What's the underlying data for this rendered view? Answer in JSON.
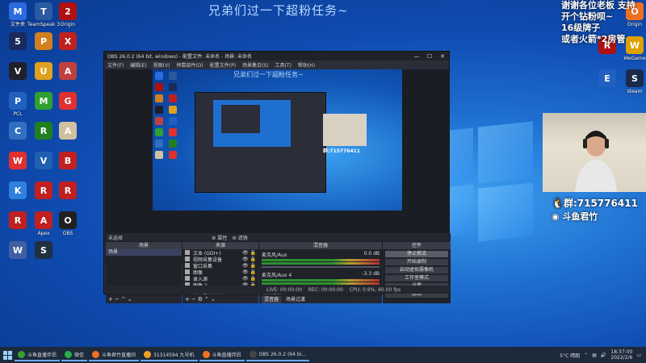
{
  "banner": "兄弟们过一下超粉任务~",
  "right_overlay": {
    "lines": [
      "谢谢各位老板 支持",
      "开个钻粉呗~",
      "16级牌子",
      "或者火箭*2房管"
    ],
    "qq": "群:715776411",
    "douyu": "斗鱼君竹"
  },
  "desktop_icons_left": [
    {
      "label": "文件夹",
      "color": "#2b6be0",
      "glyph": "M"
    },
    {
      "label": "TeamSpeak 3",
      "color": "#2a5aa0",
      "glyph": "T"
    },
    {
      "label": "Origin",
      "color": "#b01010",
      "glyph": "2"
    },
    {
      "label": "",
      "color": "#1a2a5a",
      "glyph": "5"
    },
    {
      "label": "",
      "color": "#d08020",
      "glyph": "P"
    },
    {
      "label": "",
      "color": "#c02020",
      "glyph": "X"
    },
    {
      "label": "",
      "color": "#20202a",
      "glyph": "V"
    },
    {
      "label": "",
      "color": "#e0a020",
      "glyph": "U"
    },
    {
      "label": "",
      "color": "#c04040",
      "glyph": "A"
    },
    {
      "label": "PCL",
      "color": "#2060c0",
      "glyph": "P"
    },
    {
      "label": "",
      "color": "#30a030",
      "glyph": "M"
    },
    {
      "label": "",
      "color": "#e03030",
      "glyph": "G"
    },
    {
      "label": "",
      "color": "#3070c0",
      "glyph": "C"
    },
    {
      "label": "",
      "color": "#208020",
      "glyph": "R"
    },
    {
      "label": "",
      "color": "#d0c0a0",
      "glyph": "A"
    },
    {
      "label": "",
      "color": "#e03030",
      "glyph": "W"
    },
    {
      "label": "",
      "color": "#2060b0",
      "glyph": "V"
    },
    {
      "label": "",
      "color": "#c02020",
      "glyph": "B"
    },
    {
      "label": "",
      "color": "#3080e0",
      "glyph": "K"
    },
    {
      "label": "",
      "color": "#c02020",
      "glyph": "R"
    },
    {
      "label": "",
      "color": "#c02020",
      "glyph": "R"
    },
    {
      "label": "",
      "color": "#c02020",
      "glyph": "R"
    },
    {
      "label": "Apex",
      "color": "#c02020",
      "glyph": "A"
    },
    {
      "label": "OBS",
      "color": "#202020",
      "glyph": "O"
    },
    {
      "label": "",
      "color": "#4060a0",
      "glyph": "W"
    },
    {
      "label": "",
      "color": "#203040",
      "glyph": "S"
    }
  ],
  "desktop_icons_right": [
    {
      "label": "Origin",
      "color": "#f07020",
      "glyph": "O"
    },
    {
      "label": "",
      "color": "#b01010",
      "glyph": "R"
    },
    {
      "label": "steam",
      "color": "#1a2a4a",
      "glyph": "S"
    },
    {
      "label": "",
      "color": "#2060c0",
      "glyph": "E"
    },
    {
      "label": "WeGame",
      "color": "#e0a000",
      "glyph": "W"
    }
  ],
  "obs": {
    "title": "OBS 26.0.2 (64 bit, windows) - 配置文件: 未命名 - 场景: 未命名",
    "menu": [
      "文件(F)",
      "编辑(E)",
      "视图(V)",
      "停靠部件(D)",
      "配置文件(P)",
      "场景集合(S)",
      "工具(T)",
      "帮助(H)"
    ],
    "nested_banner": "兄弟们过一下超粉任务~",
    "nested_qq": "群:715776411",
    "midbar_label": "未选择",
    "midbar_gear": "⚙ 属性",
    "midbar_filter": "⚙ 滤镜",
    "scenes_header": "场景",
    "scenes": [
      "场景"
    ],
    "sources_header": "来源",
    "sources": [
      "文本 (GDI+)",
      "视频采集设备",
      "窗口采集",
      "图像",
      "录入源",
      "图像 2",
      "桌面音频采集"
    ],
    "mixer_header": "混音器",
    "mixer": [
      {
        "name": "麦克风/Aux",
        "db": "0.0 dB"
      },
      {
        "name": "麦克风/Aux 4",
        "db": "-3.3 dB"
      }
    ],
    "transition_label": "场景过渡",
    "transition_tabs": [
      "混音器",
      "场景过渡"
    ],
    "controls_header": "控件",
    "controls": [
      "停止推流",
      "开始录制",
      "启动虚拟摄像机",
      "工作室模式",
      "设置",
      "退出"
    ],
    "status": [
      "LIVE: 00:00:00",
      "REC: 00:00:00",
      "CPU: 0.9%, 60.00 fps"
    ]
  },
  "taskbar": {
    "items": [
      {
        "label": "斗鱼直播伴侣",
        "color": "#3aa030"
      },
      {
        "label": "微信",
        "color": "#2ab04a"
      },
      {
        "label": "斗鱼君竹直播间",
        "color": "#f07020"
      },
      {
        "label": "31314594 九号机",
        "color": "#f0a020"
      },
      {
        "label": "斗鱼直播伴侣",
        "color": "#f07020"
      },
      {
        "label": "OBS 26.0.2 (64 bi...",
        "color": "#444"
      }
    ],
    "weather": "5°C 晴朗",
    "time": "18:37:00",
    "date": "2022/2/6"
  }
}
